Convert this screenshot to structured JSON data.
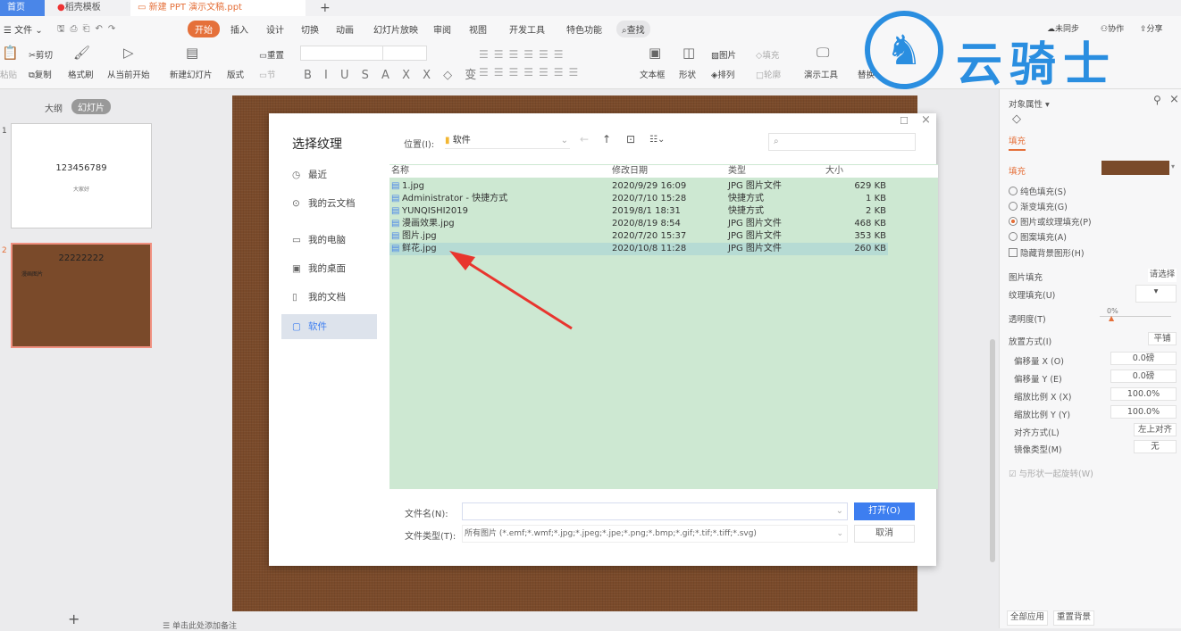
{
  "tabs": [
    {
      "label": "首页"
    },
    {
      "label": "稻壳模板"
    },
    {
      "label": "新建 PPT 演示文稿.ppt"
    }
  ],
  "watermark": "云骑士",
  "menu": {
    "file": "文件",
    "items": [
      "开始",
      "插入",
      "设计",
      "切换",
      "动画",
      "幻灯片放映",
      "审阅",
      "视图",
      "开发工具",
      "特色功能"
    ],
    "search": "查找",
    "sync": "未同步",
    "collab": "协作",
    "share": "分享"
  },
  "ribbon": {
    "paste": "粘贴",
    "cut": "剪切",
    "copy": "复制",
    "format_painter": "格式刷",
    "play_from_current": "从当前开始",
    "new_slide": "新建幻灯片",
    "layout": "版式",
    "reset": "重置",
    "section": "节",
    "textbox": "文本框",
    "shape": "形状",
    "picture": "图片",
    "fill": "填充",
    "arrange": "排列",
    "outline": "轮廓",
    "presenter_tools": "演示工具",
    "replace": "替换"
  },
  "left_panel": {
    "outline_tab": "大纲",
    "slides_tab": "幻灯片",
    "slides": [
      {
        "num": "1",
        "title": "123456789",
        "subtitle": "大家好"
      },
      {
        "num": "2",
        "title": "22222222",
        "subtitle": "漫画图片"
      }
    ],
    "add_notes": "单击此处添加备注"
  },
  "dialog": {
    "title": "选择纹理",
    "location_label": "位置(I):",
    "location": "软件",
    "sidebar": [
      "最近",
      "我的云文档",
      "我的电脑",
      "我的桌面",
      "我的文档",
      "软件"
    ],
    "selected_sidebar": "软件",
    "columns": [
      "名称",
      "修改日期",
      "类型",
      "大小"
    ],
    "files": [
      {
        "name": "1.jpg",
        "date": "2020/9/29 16:09",
        "type": "JPG 图片文件",
        "size": "629 KB"
      },
      {
        "name": "Administrator - 快捷方式",
        "date": "2020/7/10 15:28",
        "type": "快捷方式",
        "size": "1 KB"
      },
      {
        "name": "YUNQISHI2019",
        "date": "2019/8/1 18:31",
        "type": "快捷方式",
        "size": "2 KB"
      },
      {
        "name": "漫画效果.jpg",
        "date": "2020/8/19 8:54",
        "type": "JPG 图片文件",
        "size": "468 KB"
      },
      {
        "name": "图片.jpg",
        "date": "2020/7/20 15:37",
        "type": "JPG 图片文件",
        "size": "353 KB"
      },
      {
        "name": "鲜花.jpg",
        "date": "2020/10/8 11:28",
        "type": "JPG 图片文件",
        "size": "260 KB"
      }
    ],
    "selected_file": "鲜花.jpg",
    "filename_label": "文件名(N):",
    "filename_value": "",
    "filetype_label": "文件类型(T):",
    "filetype_value": "所有图片 (*.emf;*.wmf;*.jpg;*.jpeg;*.jpe;*.png;*.bmp;*.gif;*.tif;*.tiff;*.svg)",
    "open": "打开(O)",
    "cancel": "取消"
  },
  "right_panel": {
    "title": "对象属性",
    "tab": "填充",
    "section": "填充",
    "fill_color": "#7a4a2a",
    "options": [
      "纯色填充(S)",
      "渐变填充(G)",
      "图片或纹理填充(P)",
      "图案填充(A)"
    ],
    "selected_option": "图片或纹理填充(P)",
    "hide_bg": "隐藏背景图形(H)",
    "picture_fill": "图片填充",
    "picture_choose": "请选择",
    "texture_fill": "纹理填充(U)",
    "transparency": "透明度(T)",
    "transparency_value": "0%",
    "placement": "放置方式(I)",
    "placement_value": "平铺",
    "offset_x": "偏移量 X (O)",
    "offset_x_value": "0.0磅",
    "offset_y": "偏移量 Y (E)",
    "offset_y_value": "0.0磅",
    "scale_x": "缩放比例 X (X)",
    "scale_x_value": "100.0%",
    "scale_y": "缩放比例 Y (Y)",
    "scale_y_value": "100.0%",
    "align": "对齐方式(L)",
    "align_value": "左上对齐",
    "mirror": "镜像类型(M)",
    "mirror_value": "无",
    "rotate_with_shape": "与形状一起旋转(W)",
    "apply_all": "全部应用",
    "reset_bg": "重置背景"
  },
  "colors": {
    "accent": "#e5703a",
    "primary_button": "#3d7ef0",
    "list_bg": "#cde8d2",
    "arrow": "#e8352e"
  }
}
